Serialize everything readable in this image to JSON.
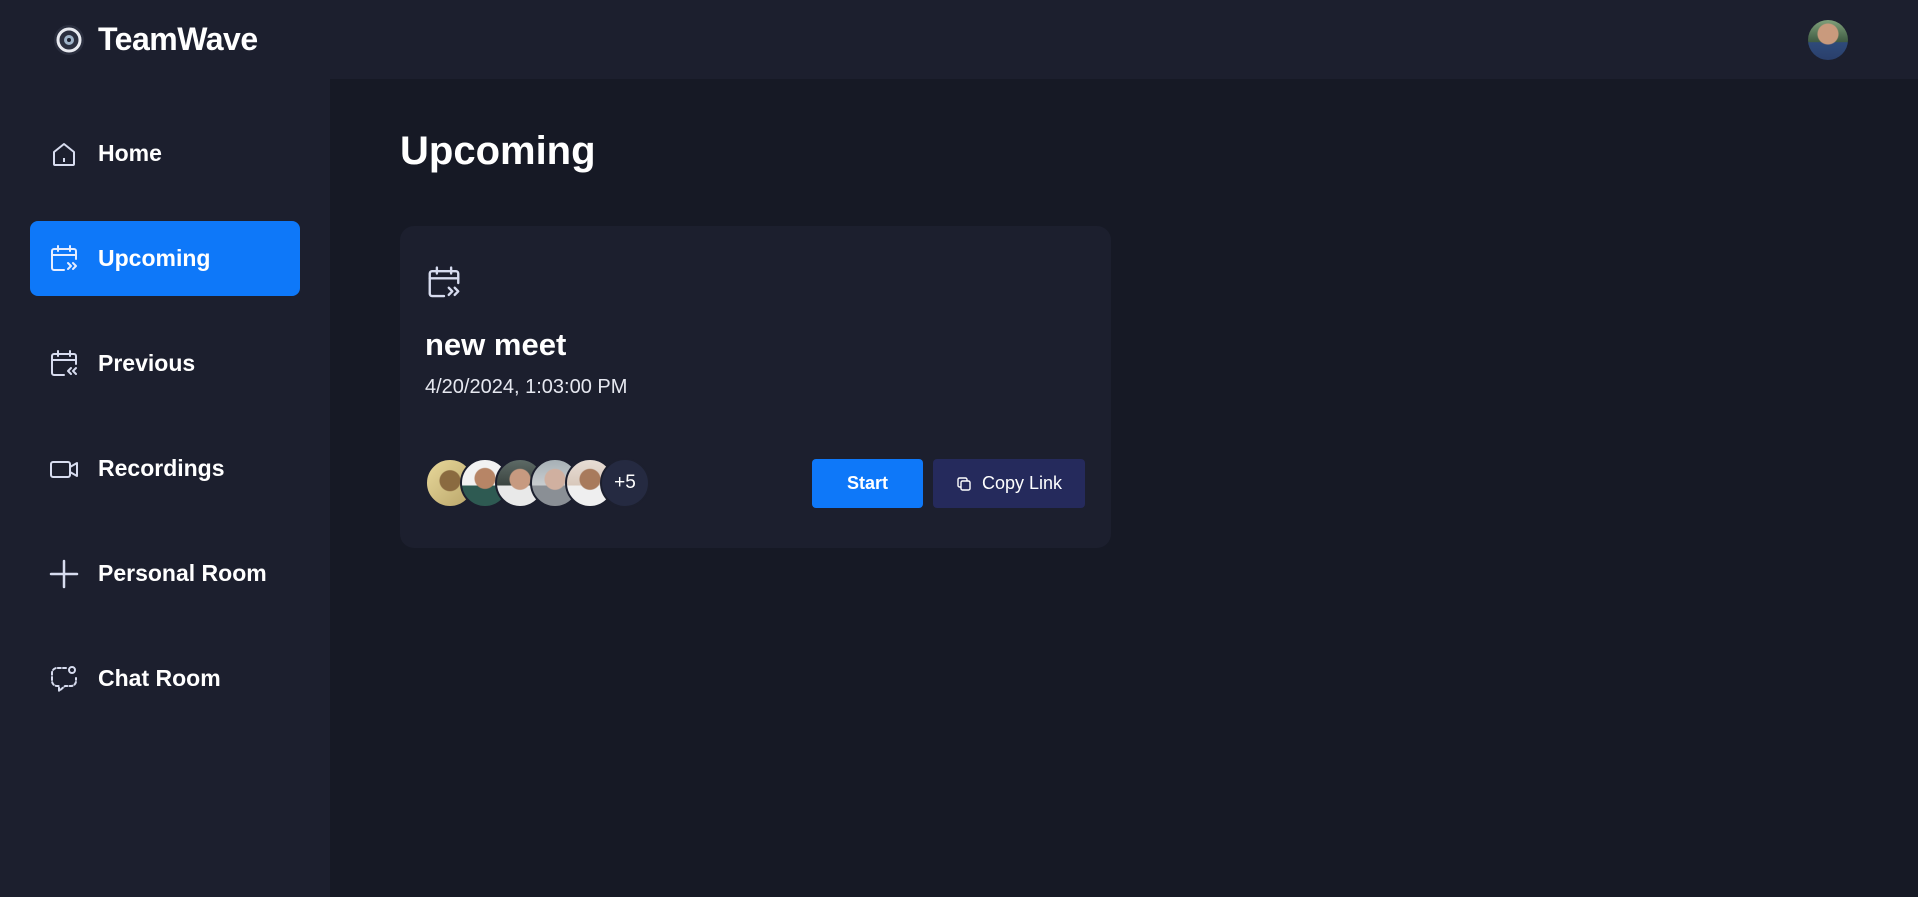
{
  "app": {
    "name": "TeamWave"
  },
  "sidebar": {
    "items": [
      {
        "label": "Home",
        "icon": "home-icon",
        "active": false
      },
      {
        "label": "Upcoming",
        "icon": "calendar-upcoming-icon",
        "active": true
      },
      {
        "label": "Previous",
        "icon": "calendar-previous-icon",
        "active": false
      },
      {
        "label": "Recordings",
        "icon": "video-icon",
        "active": false
      },
      {
        "label": "Personal Room",
        "icon": "plus-icon",
        "active": false
      },
      {
        "label": "Chat Room",
        "icon": "chat-icon",
        "active": false
      }
    ]
  },
  "main": {
    "title": "Upcoming",
    "meeting": {
      "title": "new meet",
      "date": "4/20/2024, 1:03:00 PM",
      "extra_attendees": "+5",
      "start_label": "Start",
      "copy_label": "Copy Link"
    }
  },
  "colors": {
    "accent": "#0e78f9",
    "panel": "#1c1f2e",
    "background": "#161925",
    "copy_button": "#252a5c"
  }
}
